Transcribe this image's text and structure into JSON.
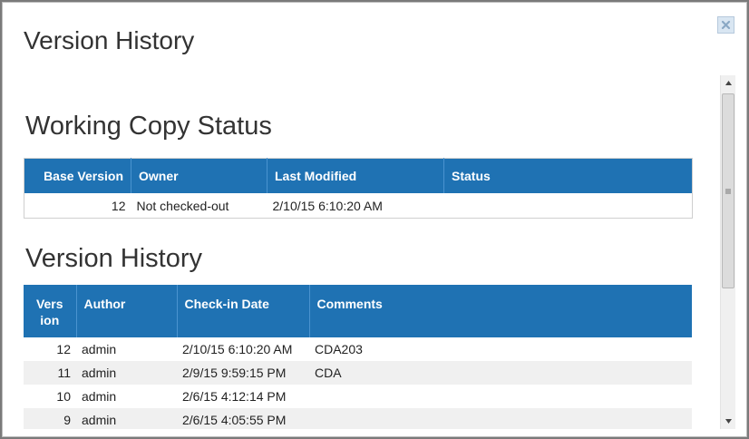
{
  "dialog": {
    "title": "Version History"
  },
  "working_copy": {
    "title": "Working Copy Status",
    "columns": [
      "Base Version",
      "Owner",
      "Last Modified",
      "Status"
    ],
    "row": {
      "base_version": "12",
      "owner": "Not checked-out",
      "last_modified": "2/10/15 6:10:20 AM",
      "status": ""
    }
  },
  "version_history": {
    "title": "Version History",
    "columns": [
      "Version",
      "Author",
      "Check-in Date",
      "Comments"
    ],
    "rows": [
      {
        "version": "12",
        "author": "admin",
        "date": "2/10/15 6:10:20 AM",
        "comments": "CDA203"
      },
      {
        "version": "11",
        "author": "admin",
        "date": "2/9/15 9:59:15 PM",
        "comments": "CDA"
      },
      {
        "version": "10",
        "author": "admin",
        "date": "2/6/15 4:12:14 PM",
        "comments": ""
      },
      {
        "version": "9",
        "author": "admin",
        "date": "2/6/15 4:05:55 PM",
        "comments": ""
      }
    ]
  },
  "colors": {
    "header_bg": "#1f72b3",
    "header_text": "#ffffff",
    "alt_row_bg": "#f0f0f0"
  }
}
